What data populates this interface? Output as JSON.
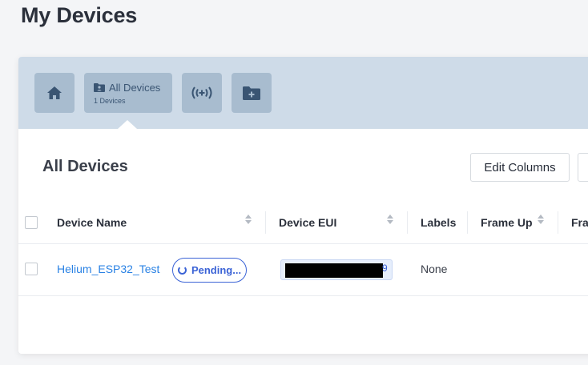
{
  "page": {
    "title": "My Devices"
  },
  "toolbar": {
    "home_icon": "home-icon",
    "all_devices": {
      "label": "All Devices",
      "sub": "1 Devices",
      "icon": "folder-user-icon"
    },
    "radio_icon": "broadcast-icon",
    "add_folder_icon": "folder-plus-icon"
  },
  "section": {
    "title": "All Devices",
    "edit_columns_label": "Edit Columns"
  },
  "table": {
    "headers": {
      "device_name": "Device Name",
      "device_eui": "Device EUI",
      "labels": "Labels",
      "frame_up": "Frame Up",
      "frame_down_partial": "Fra"
    },
    "rows": [
      {
        "device_name": "Helium_ESP32_Test",
        "status": "Pending...",
        "eui_tail": "9",
        "labels": "None"
      }
    ]
  },
  "colors": {
    "accent": "#3b63d6",
    "link": "#2a82e4",
    "toolbar_bg": "#cedbe8",
    "toolbar_btn": "#a8bccf"
  }
}
